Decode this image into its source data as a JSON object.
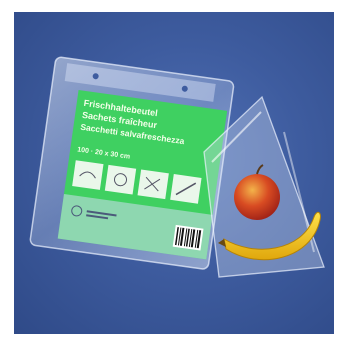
{
  "product": {
    "headline_de": "Frischhaltebeutel",
    "headline_fr": "Sachets fraîcheur",
    "headline_it": "Sacchetti salvafreschezza",
    "size_info": "100 · 20 x 30 cm"
  },
  "colors": {
    "background_blue": "#3e5c9f",
    "label_green": "#3fd061",
    "banana_yellow": "#f2c21a",
    "apple_red": "#c8301e"
  },
  "icons": [
    "leaf-symbol-icon",
    "snowflake-icon",
    "scissors-icon",
    "knife-icon",
    "recycling-icon",
    "barcode-icon"
  ]
}
